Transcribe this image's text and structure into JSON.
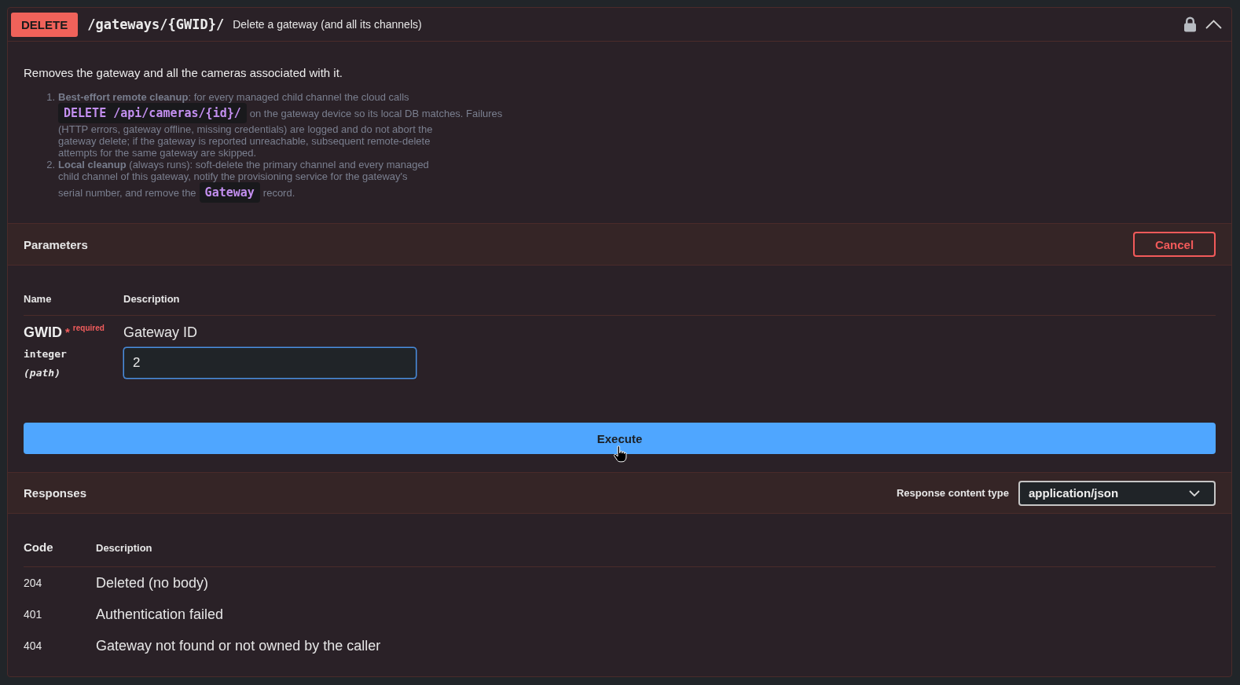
{
  "operation": {
    "method": "DELETE",
    "path": "/gateways/{GWID}/",
    "summary": "Delete a gateway (and all its channels)",
    "locked": true,
    "expanded": true
  },
  "description": {
    "intro": "Removes the gateway and all the cameras associated with it.",
    "steps": [
      {
        "marker": "1.",
        "lines": [
          [
            {
              "kind": "text",
              "text": "**Best-effort remote cleanup**: for every managed child channel the cloud calls"
            }
          ],
          [
            {
              "kind": "code",
              "text": "DELETE /api/cameras/{id}/"
            },
            {
              "kind": "text",
              "text": "on the gateway device so its local DB matches. Failures"
            }
          ],
          [
            {
              "kind": "text",
              "text": "(HTTP errors, gateway offline, missing credentials) are logged and do not abort the"
            }
          ],
          [
            {
              "kind": "text",
              "text": "gateway delete; if the gateway is reported unreachable, subsequent remote-delete"
            }
          ],
          [
            {
              "kind": "text",
              "text": "attempts for the same gateway are skipped."
            }
          ]
        ]
      },
      {
        "marker": "2.",
        "lines": [
          [
            {
              "kind": "text",
              "text": "**Local cleanup** (always runs): soft-delete the primary channel and every managed"
            }
          ],
          [
            {
              "kind": "text",
              "text": "child channel of this gateway, notify the provisioning service for the gateway's"
            }
          ],
          [
            {
              "kind": "text",
              "text": "serial number, and remove the"
            },
            {
              "kind": "code",
              "text": "Gateway"
            },
            {
              "kind": "text",
              "text": "record."
            }
          ]
        ]
      }
    ]
  },
  "parameters": {
    "title": "Parameters",
    "cancel_button": "Cancel",
    "columns": [
      "Name",
      "Description"
    ],
    "rows": [
      {
        "name": "GWID",
        "required_mark": "*",
        "required_label": "required",
        "type": "integer",
        "location": "(path)",
        "description": "Gateway ID",
        "value": "2",
        "focused": true
      }
    ]
  },
  "execute_button": "Execute",
  "responses": {
    "title": "Responses",
    "content_type_label": "Response content type",
    "content_type": "application/json",
    "columns": [
      "Code",
      "Description"
    ],
    "rows": [
      {
        "code": "204",
        "description": "Deleted (no body)"
      },
      {
        "code": "401",
        "description": "Authentication failed"
      },
      {
        "code": "404",
        "description": "Gateway not found or not owned by the caller"
      }
    ]
  }
}
